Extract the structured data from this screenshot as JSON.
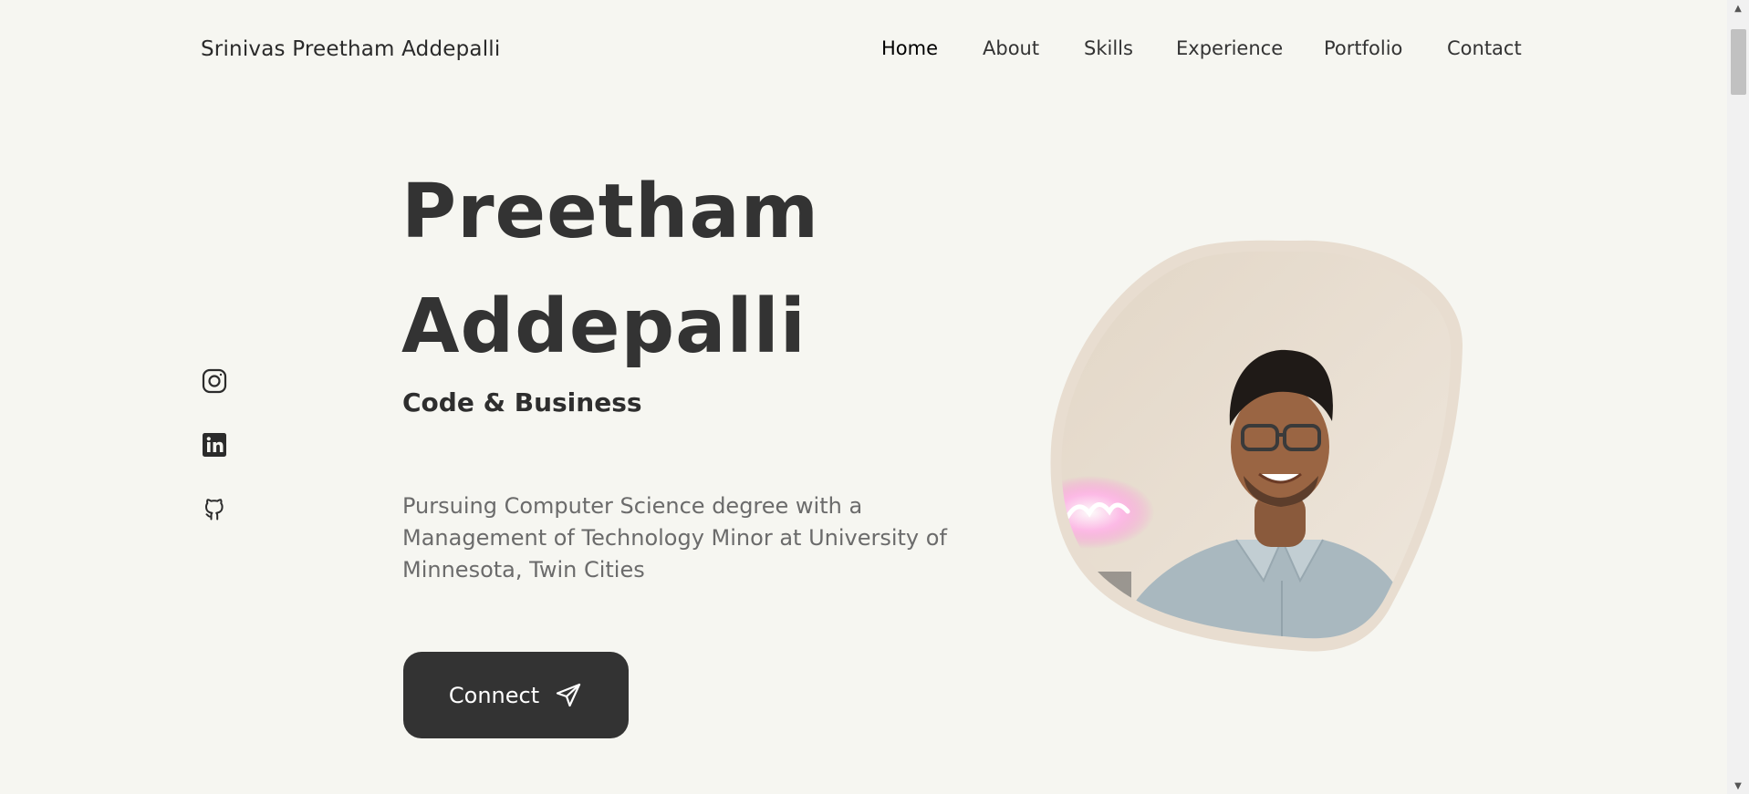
{
  "header": {
    "brand": "Srinivas Preetham Addepalli",
    "nav": [
      {
        "label": "Home",
        "active": true
      },
      {
        "label": "About",
        "active": false
      },
      {
        "label": "Skills",
        "active": false
      },
      {
        "label": "Experience",
        "active": false
      },
      {
        "label": "Portfolio",
        "active": false
      },
      {
        "label": "Contact",
        "active": false
      }
    ]
  },
  "social": [
    {
      "icon": "instagram-icon"
    },
    {
      "icon": "linkedin-icon"
    },
    {
      "icon": "github-icon"
    }
  ],
  "hero": {
    "name_line1": "Preetham",
    "name_line2": "Addepalli",
    "subtitle": "Code & Business",
    "description": "Pursuing Computer Science degree with a Management of Technology Minor at University of Minnesota, Twin Cities",
    "button_label": "Connect",
    "button_icon": "send-icon"
  },
  "colors": {
    "background": "#f6f6f1",
    "text": "#333333",
    "muted": "#6b6b6b",
    "button": "#333333",
    "blob_border": "#e6dbcf"
  }
}
